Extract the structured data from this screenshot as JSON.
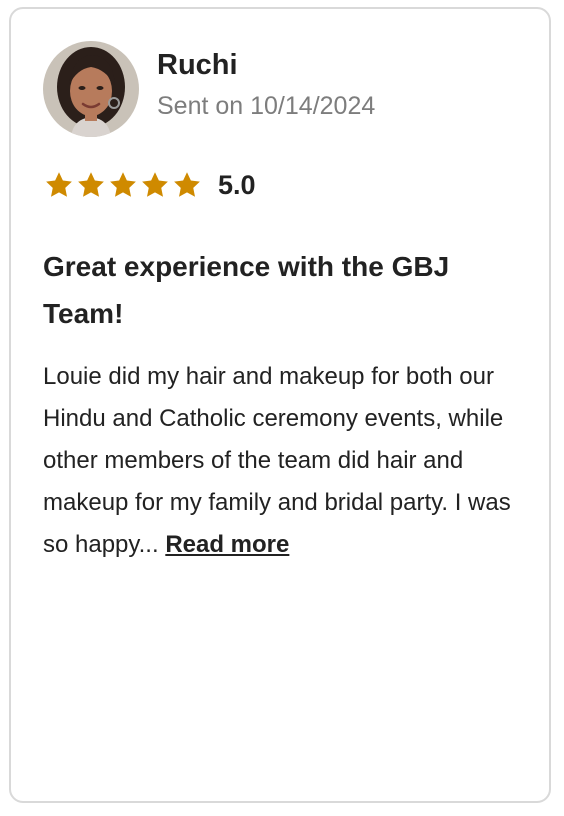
{
  "review": {
    "reviewer_name": "Ruchi",
    "sent_text": "Sent on 10/14/2024",
    "rating": {
      "stars": 5,
      "value_text": "5.0",
      "star_color": "#cf8a00"
    },
    "title_line1": "Great experience with the GBJ",
    "title_line2": "Team!",
    "body_text": "Louie did my hair and makeup for both our Hindu and Catholic ceremony events, while other members of the team did hair and makeup for my family and bridal party. I was so happy...",
    "read_more_label": "Read more"
  }
}
